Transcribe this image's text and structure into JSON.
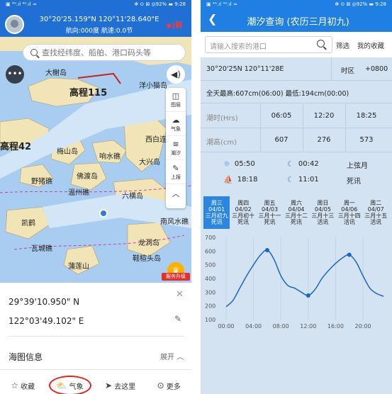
{
  "left": {
    "status": {
      "left": "▣ ⁴ᴳ.ıl ⁴ᴳ.ıl ≈",
      "right": "✻ ⊙ ⊠ ◎92% ▬ 9:28"
    },
    "header": {
      "coords": "30°20'25.159\"N 120°11'28.640\"E",
      "speed": "航向:000度 航速:0.0节"
    },
    "search_placeholder": "查找经纬度、船舶、港口码头等",
    "tools": [
      {
        "icon": "layers-icon",
        "label": "图层"
      },
      {
        "icon": "cloud-icon",
        "label": "气象"
      },
      {
        "icon": "tide-icon",
        "label": "潮汐"
      },
      {
        "icon": "pencil-icon",
        "label": "上报"
      },
      {
        "icon": "chevron-up-icon",
        "label": ""
      }
    ],
    "map_labels": [
      {
        "text": "大榭岛"
      },
      {
        "text": "高程115"
      },
      {
        "text": "洋小猫岛"
      },
      {
        "text": "西白连"
      },
      {
        "text": "高程42"
      },
      {
        "text": "梅山岛"
      },
      {
        "text": "响水礁"
      },
      {
        "text": "大兴岛"
      },
      {
        "text": "佛渡岛"
      },
      {
        "text": "野猪礁"
      },
      {
        "text": "温州礁"
      },
      {
        "text": "六横岛"
      },
      {
        "text": "南风水礁"
      },
      {
        "text": "凯鹤"
      },
      {
        "text": "龙洞岛"
      },
      {
        "text": "瓦城礁"
      },
      {
        "text": "鞋楦头岛"
      },
      {
        "text": "蒲莲山"
      }
    ],
    "upgrade_label": "服务升级",
    "info": {
      "lat": "29°39'10.950\" N",
      "lon": "122°03'49.102\" E",
      "chart_info": "海图信息",
      "expand": "展开"
    },
    "actions": [
      {
        "icon": "star-icon",
        "label": "收藏"
      },
      {
        "icon": "weather-icon",
        "label": "气象"
      },
      {
        "icon": "navigate-icon",
        "label": "去这里"
      },
      {
        "icon": "more-icon",
        "label": "更多"
      }
    ]
  },
  "right": {
    "status": {
      "left": "▣ ⁴ᴳ.ıl ⁴ᴳ.ıl ≈",
      "right": "✻ ⊙ ⊠ ◎92% ▬ 9:28"
    },
    "title": "潮汐查询 (农历三月初九)",
    "search_placeholder": "请输入搜索的港口",
    "filter": "筛选",
    "favorites": "我的收藏",
    "position": "30°20'25N 120°11'28E",
    "timezone_label": "时区",
    "timezone": "+0800",
    "summary": "全天最高:607cm(06:00) 最低:194cm(00:00)",
    "tide_times": {
      "header": "潮时(Hrs)",
      "values": [
        "06:05",
        "12:20",
        "18:25"
      ]
    },
    "tide_heights": {
      "header": "潮高(cm)",
      "values": [
        "607",
        "276",
        "573"
      ]
    },
    "sun_moon": [
      {
        "icon": "sunrise-icon",
        "value": "05:50"
      },
      {
        "icon": "moonrise-icon",
        "value": "00:42"
      },
      {
        "icon": "",
        "value": "上弦月"
      },
      {
        "icon": "sunset-icon",
        "value": "18:18"
      },
      {
        "icon": "moonset-icon",
        "value": "11:01"
      },
      {
        "icon": "",
        "value": "死讯"
      }
    ],
    "days": [
      {
        "week": "周三",
        "date": "04/01",
        "lunar": "三月初九",
        "tide": "死讯"
      },
      {
        "week": "周四",
        "date": "04/02",
        "lunar": "三月初十",
        "tide": "死讯"
      },
      {
        "week": "周五",
        "date": "04/03",
        "lunar": "三月十一",
        "tide": "死讯"
      },
      {
        "week": "周六",
        "date": "04/04",
        "lunar": "三月十二",
        "tide": "死讯"
      },
      {
        "week": "周日",
        "date": "04/05",
        "lunar": "三月十三",
        "tide": "活讯"
      },
      {
        "week": "周一",
        "date": "04/06",
        "lunar": "三月十四",
        "tide": "活讯"
      },
      {
        "week": "周二",
        "date": "04/07",
        "lunar": "三月十五",
        "tide": "活讯"
      }
    ]
  },
  "colors": {
    "header_blue": "#1f7fe2",
    "panel_bg": "#d4e3f2",
    "selected_day": "#2a86e0",
    "curve": "#1a65c8",
    "highlight_red": "#e0221b"
  },
  "chart_data": {
    "type": "line",
    "title": "",
    "xlabel": "",
    "ylabel": "",
    "x_ticks": [
      "00:00",
      "04:00",
      "08:00",
      "12:00",
      "16:00",
      "20:00"
    ],
    "y_ticks": [
      100,
      200,
      300,
      400,
      500,
      600,
      700
    ],
    "ylim": [
      100,
      700
    ],
    "xlim": [
      0,
      23
    ],
    "grid": "vertical",
    "series": [
      {
        "x": [
          0,
          1,
          2,
          3,
          4,
          5,
          6,
          7,
          8,
          9,
          10,
          11,
          12,
          13,
          14,
          15,
          16,
          17,
          18,
          19,
          20,
          21,
          22,
          23
        ],
        "values": [
          194,
          240,
          330,
          420,
          500,
          570,
          607,
          540,
          420,
          350,
          330,
          300,
          276,
          320,
          400,
          460,
          510,
          550,
          573,
          520,
          420,
          330,
          290,
          270
        ]
      }
    ],
    "markers": [
      {
        "x": 6,
        "y": 607
      },
      {
        "x": 12,
        "y": 276
      },
      {
        "x": 18,
        "y": 573
      }
    ]
  }
}
